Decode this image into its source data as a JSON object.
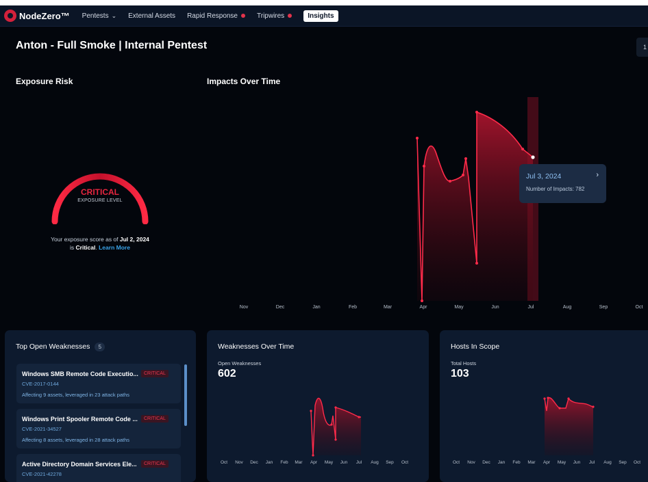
{
  "nav": {
    "brand": "NodeZero™",
    "items": [
      {
        "label": "Pentests",
        "chevron": true,
        "dot": false,
        "active": false
      },
      {
        "label": "External Assets",
        "chevron": false,
        "dot": false,
        "active": false
      },
      {
        "label": "Rapid Response",
        "chevron": false,
        "dot": true,
        "active": false
      },
      {
        "label": "Tripwires",
        "chevron": false,
        "dot": true,
        "active": false
      },
      {
        "label": "Insights",
        "chevron": false,
        "dot": false,
        "active": true
      }
    ]
  },
  "page_title": "Anton - Full Smoke | Internal Pentest",
  "top_right_button": "1",
  "exposure": {
    "title": "Exposure Risk",
    "level": "CRITICAL",
    "level_sub": "EXPOSURE LEVEL",
    "score_prefix": "Your exposure score as of ",
    "score_date": "Jul 2, 2024",
    "score_is": "is ",
    "score_word": "Critical",
    "learn_more": "Learn More",
    "gauge_color": "#e11d3a"
  },
  "impacts": {
    "title": "Impacts Over Time",
    "tooltip_date": "Jul 3, 2024",
    "tooltip_count": "Number of Impacts: 782",
    "months": [
      "Nov",
      "Dec",
      "Jan",
      "Feb",
      "Mar",
      "Apr",
      "May",
      "Jun",
      "Jul",
      "Aug",
      "Sep",
      "Oct"
    ]
  },
  "weaknesses": {
    "title": "Top Open Weaknesses",
    "count": "5",
    "items": [
      {
        "name": "Windows SMB Remote Code Executio...",
        "severity": "CRITICAL",
        "cve": "CVE-2017-0144",
        "affecting": "Affecting 9 assets, leveraged in 23 attack paths"
      },
      {
        "name": "Windows Print Spooler Remote Code ...",
        "severity": "CRITICAL",
        "cve": "CVE-2021-34527",
        "affecting": "Affecting 8 assets, leveraged in 28 attack paths"
      },
      {
        "name": "Active Directory Domain Services Ele...",
        "severity": "CRITICAL",
        "cve": "CVE-2021-42278",
        "affecting": ""
      }
    ]
  },
  "weaknesses_over_time": {
    "title": "Weaknesses Over Time",
    "label": "Open Weaknesses",
    "value": "602",
    "months": [
      "Oct",
      "Nov",
      "Dec",
      "Jan",
      "Feb",
      "Mar",
      "Apr",
      "May",
      "Jun",
      "Jul",
      "Aug",
      "Sep",
      "Oct"
    ]
  },
  "hosts": {
    "title": "Hosts In Scope",
    "label": "Total Hosts",
    "value": "103",
    "months": [
      "Oct",
      "Nov",
      "Dec",
      "Jan",
      "Feb",
      "Mar",
      "Apr",
      "May",
      "Jun",
      "Jul",
      "Aug",
      "Sep",
      "Oct"
    ]
  },
  "colors": {
    "accent_red": "#e8263f",
    "background": "#03060c",
    "card": "#0d1a2e",
    "link": "#3aa3e8"
  }
}
